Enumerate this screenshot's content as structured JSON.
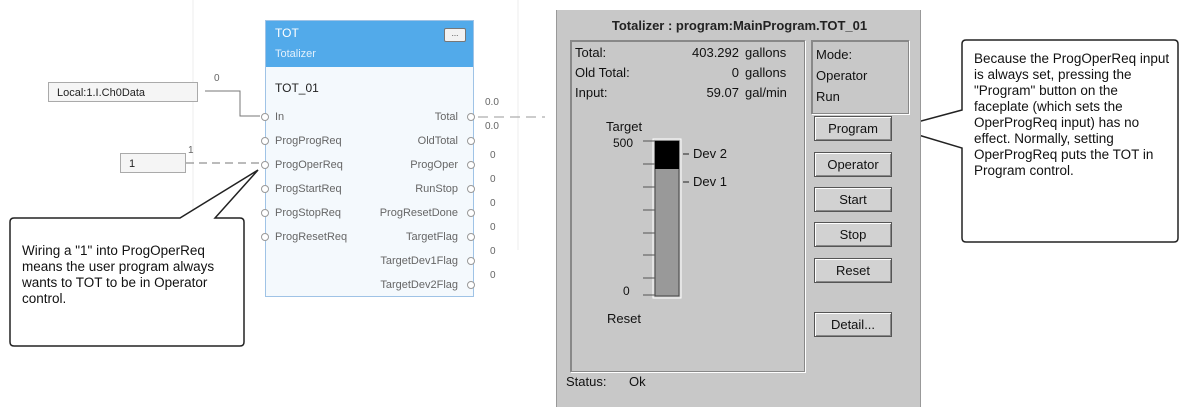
{
  "block": {
    "name": "TOT",
    "description": "Totalizer",
    "more_button": "...",
    "tag": "TOT_01",
    "inputs": [
      "In",
      "ProgProgReq",
      "ProgOperReq",
      "ProgStartReq",
      "ProgStopReq",
      "ProgResetReq"
    ],
    "outputs": [
      "Total",
      "OldTotal",
      "ProgOper",
      "RunStop",
      "ProgResetDone",
      "TargetFlag",
      "TargetDev1Flag",
      "TargetDev2Flag"
    ],
    "output_values": [
      "0.0",
      "0.0",
      "0",
      "0",
      "0",
      "0",
      "0",
      "0"
    ]
  },
  "wiring": {
    "input_tag": "Local:1.I.Ch0Data",
    "input_tag_value": "0",
    "constant": "1",
    "constant_value": "1"
  },
  "left_callout": "Wiring a \"1\" into ProgOperReq means the user program always wants to TOT to be in Operator control.",
  "right_callout": "Because the ProgOperReq input is always set, pressing the \"Program\" button on the faceplate (which sets the OperProgReq input) has no effect. Normally, setting OperProgReq puts the TOT in Program control.",
  "faceplate": {
    "title": "Totalizer : program:MainProgram.TOT_01",
    "total_label": "Total:",
    "total_value": "403.292",
    "total_unit": "gallons",
    "old_total_label": "Old Total:",
    "old_total_value": "0",
    "old_total_unit": "gallons",
    "input_label": "Input:",
    "input_value": "59.07",
    "input_unit": "gal/min",
    "target_label": "Target",
    "scale_top": "500",
    "scale_bottom": "0",
    "dev2": "Dev 2",
    "dev1": "Dev 1",
    "reset_label": "Reset",
    "mode_label": "Mode:",
    "mode_value": "Operator",
    "run_state": "Run",
    "buttons": {
      "program": "Program",
      "operator": "Operator",
      "start": "Start",
      "stop": "Stop",
      "reset": "Reset",
      "detail": "Detail..."
    },
    "status_label": "Status:",
    "status_value": "Ok",
    "colors": {
      "background": "#c8c8c8",
      "bar_fill": "#999999",
      "dev2_band": "#000000"
    }
  }
}
